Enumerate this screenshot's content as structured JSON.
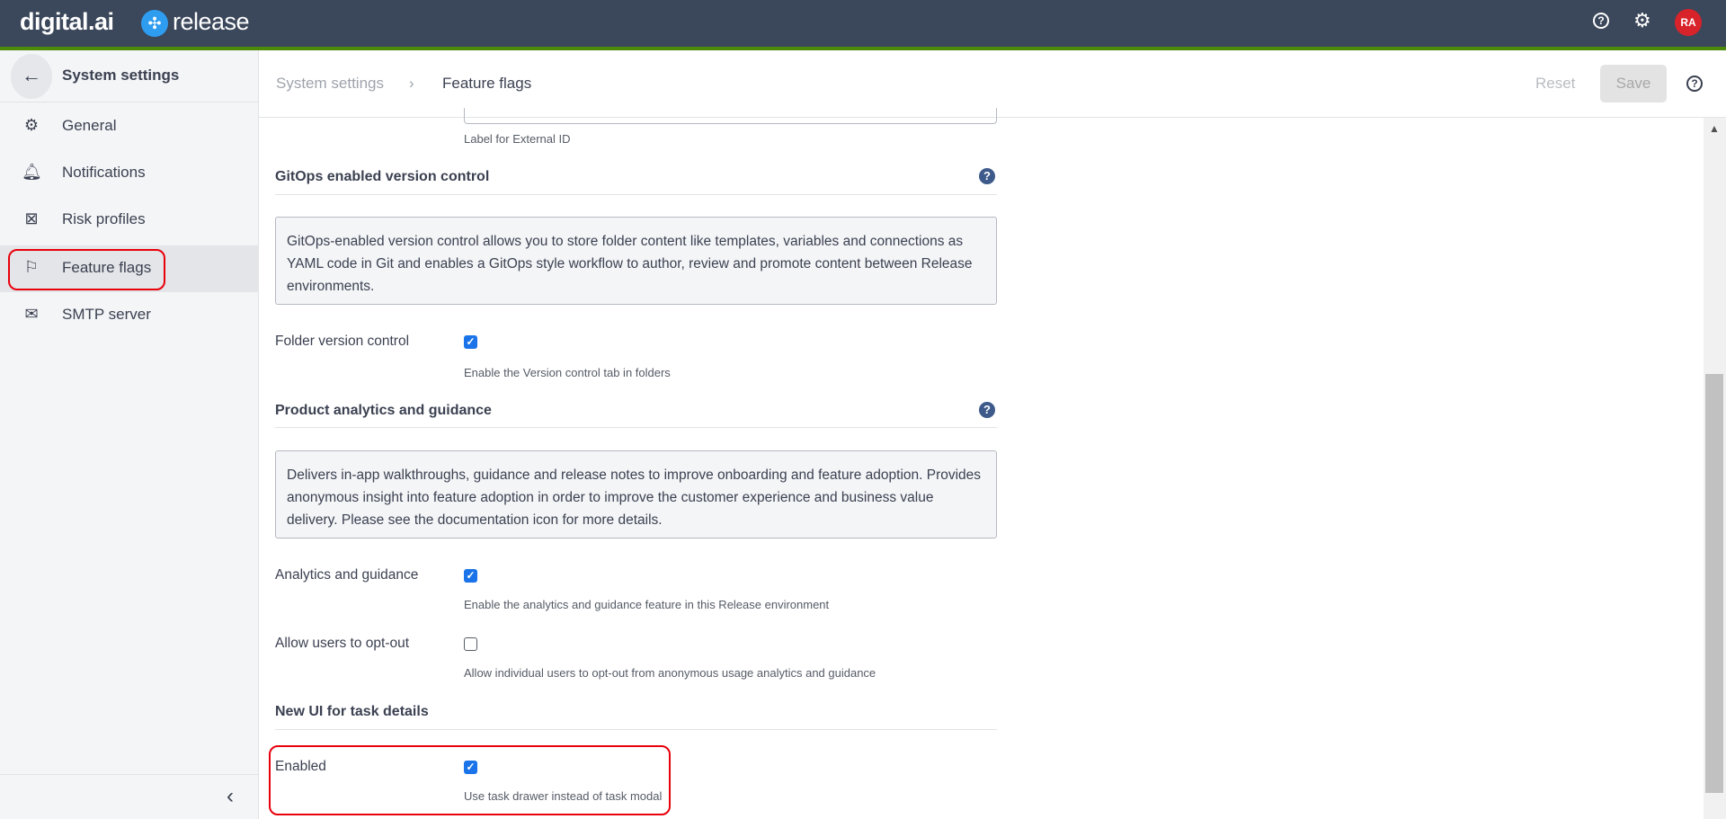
{
  "header": {
    "brand": "digital.ai",
    "product": "release",
    "avatar_initials": "RA",
    "icons": [
      "help-icon",
      "gear-icon"
    ]
  },
  "sidebar": {
    "title": "System settings",
    "items": [
      {
        "label": "General",
        "icon": "gear-icon"
      },
      {
        "label": "Notifications",
        "icon": "bell-icon"
      },
      {
        "label": "Risk profiles",
        "icon": "risk-icon"
      },
      {
        "label": "Feature flags",
        "icon": "flag-icon",
        "active": true
      },
      {
        "label": "SMTP server",
        "icon": "mail-icon"
      }
    ]
  },
  "breadcrumb": {
    "parent": "System settings",
    "current": "Feature flags"
  },
  "toolbar": {
    "reset": "Reset",
    "save": "Save"
  },
  "content": {
    "external_id_desc": "Label for External ID",
    "gitops": {
      "heading": "GitOps enabled version control",
      "info": "GitOps-enabled version control allows you to store folder content like templates, variables and connections as YAML code in Git and enables a GitOps style workflow to author, review and promote content between Release environments.",
      "folder_label": "Folder version control",
      "folder_checked": true,
      "folder_desc": "Enable the Version control tab in folders"
    },
    "analytics": {
      "heading": "Product analytics and guidance",
      "info": "Delivers in-app walkthroughs, guidance and release notes to improve onboarding and feature adoption. Provides anonymous insight into feature adoption in order to improve the customer experience and business value delivery. Please see the documentation icon for more details.",
      "enabled_label": "Analytics and guidance",
      "enabled_checked": true,
      "enabled_desc": "Enable the analytics and guidance feature in this Release environment",
      "optout_label": "Allow users to opt-out",
      "optout_checked": false,
      "optout_desc": "Allow individual users to opt-out from anonymous usage analytics and guidance"
    },
    "task_ui": {
      "heading": "New UI for task details",
      "enabled_label": "Enabled",
      "enabled_checked": true,
      "enabled_desc": "Use task drawer instead of task modal"
    }
  },
  "colors": {
    "topbar": "#3b475a",
    "accent_line": "#4c8a0a",
    "checkbox": "#1a73e8",
    "highlight": "#e8000b"
  }
}
